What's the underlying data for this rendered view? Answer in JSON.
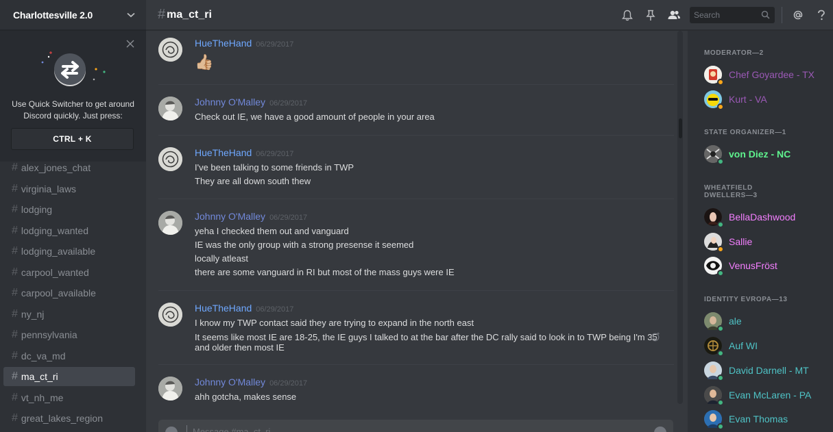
{
  "server": {
    "name": "Charlottesville 2.0"
  },
  "quick_switcher": {
    "text": "Use Quick Switcher to get around Discord quickly. Just press:",
    "shortcut": "CTRL + K"
  },
  "channels": [
    {
      "name": "alex_jones_chat"
    },
    {
      "name": "virginia_laws"
    },
    {
      "name": "lodging"
    },
    {
      "name": "lodging_wanted"
    },
    {
      "name": "lodging_available"
    },
    {
      "name": "carpool_wanted"
    },
    {
      "name": "carpool_available"
    },
    {
      "name": "ny_nj"
    },
    {
      "name": "pennsylvania"
    },
    {
      "name": "dc_va_md"
    },
    {
      "name": "ma_ct_ri",
      "active": true
    },
    {
      "name": "vt_nh_me"
    },
    {
      "name": "great_lakes_region"
    }
  ],
  "header": {
    "channel": "ma_ct_ri",
    "search_placeholder": "Search"
  },
  "messages": [
    {
      "author": "HueTheHand",
      "timestamp": "06/29/2017",
      "lines": [
        "👍🏼"
      ]
    },
    {
      "author": "Johnny O'Malley",
      "timestamp": "06/29/2017",
      "lines": [
        "Check out IE, we have a good amount of people in your area"
      ]
    },
    {
      "author": "HueTheHand",
      "timestamp": "06/29/2017",
      "lines": [
        "I've been talking to some friends in TWP",
        "They are all down south thew"
      ]
    },
    {
      "author": "Johnny O'Malley",
      "timestamp": "06/29/2017",
      "lines": [
        "yeha I checked them out and vanguard",
        "IE was the only group with a strong presense it seemed",
        "locally atleast",
        "there are some vanguard in RI but most of the mass guys were IE"
      ]
    },
    {
      "author": "HueTheHand",
      "timestamp": "06/29/2017",
      "lines": [
        "I know my TWP contact said they are trying to expand in the north east",
        "It seems like most IE are 18-25, the IE guys I talked to at the bar after the DC rally said to look in to TWP being I'm 35",
        "and older then most IE"
      ]
    },
    {
      "author": "Johnny O'Malley",
      "timestamp": "06/29/2017",
      "lines": [
        "ahh gotcha, makes sense"
      ]
    }
  ],
  "composer": {
    "placeholder": "Message #ma_ct_ri"
  },
  "members": {
    "roles": [
      {
        "title": "MODERATOR—2",
        "members": [
          {
            "name": "Chef Goyardee - TX",
            "color": "#9b59b6",
            "status": "#faa61a"
          },
          {
            "name": "Kurt - VA",
            "color": "#9b59b6",
            "status": "#faa61a"
          }
        ]
      },
      {
        "title": "STATE ORGANIZER—1",
        "members": [
          {
            "name": "von Diez - NC",
            "color": "#5ff38e",
            "status": "#43b581"
          }
        ]
      },
      {
        "title": "WHEATFIELD DWELLERS—3",
        "members": [
          {
            "name": "BellaDashwood",
            "color": "#f47fff",
            "status": "#43b581"
          },
          {
            "name": "Sallie",
            "color": "#f47fff",
            "status": "#faa61a"
          },
          {
            "name": "VenusFröst",
            "color": "#f47fff",
            "status": "#43b581"
          }
        ]
      },
      {
        "title": "IDENTITY EVROPA—13",
        "members": [
          {
            "name": "ale",
            "color": "#4fc3c6",
            "status": "#43b581"
          },
          {
            "name": "Auf WI",
            "color": "#4fc3c6",
            "status": "#43b581"
          },
          {
            "name": "David Darnell - MT",
            "color": "#4fc3c6",
            "status": "#43b581"
          },
          {
            "name": "Evan McLaren - PA",
            "color": "#4fc3c6",
            "status": "#43b581"
          },
          {
            "name": "Evan Thomas",
            "color": "#4fc3c6",
            "status": "#43b581"
          }
        ]
      }
    ]
  }
}
